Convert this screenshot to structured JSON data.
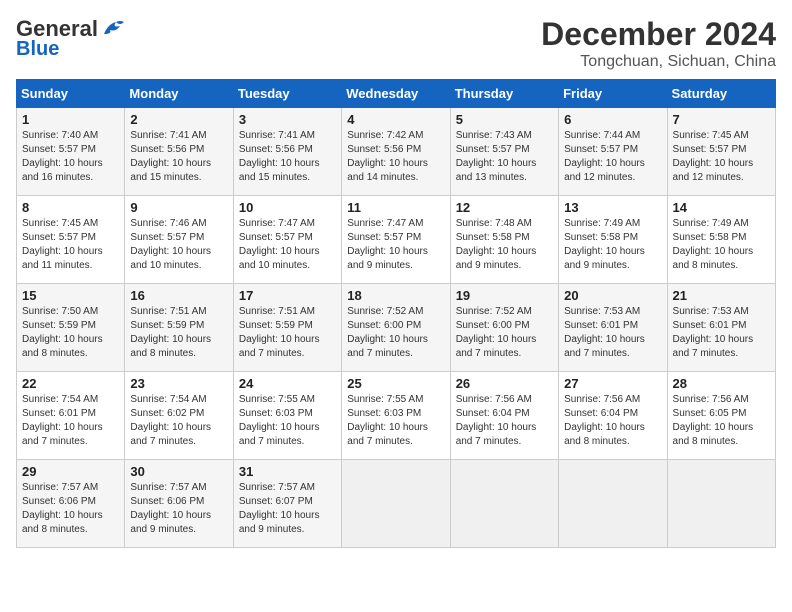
{
  "header": {
    "logo_general": "General",
    "logo_blue": "Blue",
    "month_title": "December 2024",
    "location": "Tongchuan, Sichuan, China"
  },
  "weekdays": [
    "Sunday",
    "Monday",
    "Tuesday",
    "Wednesday",
    "Thursday",
    "Friday",
    "Saturday"
  ],
  "weeks": [
    [
      {
        "day": "1",
        "sunrise": "7:40 AM",
        "sunset": "5:57 PM",
        "daylight": "10 hours and 16 minutes."
      },
      {
        "day": "2",
        "sunrise": "7:41 AM",
        "sunset": "5:56 PM",
        "daylight": "10 hours and 15 minutes."
      },
      {
        "day": "3",
        "sunrise": "7:41 AM",
        "sunset": "5:56 PM",
        "daylight": "10 hours and 15 minutes."
      },
      {
        "day": "4",
        "sunrise": "7:42 AM",
        "sunset": "5:56 PM",
        "daylight": "10 hours and 14 minutes."
      },
      {
        "day": "5",
        "sunrise": "7:43 AM",
        "sunset": "5:57 PM",
        "daylight": "10 hours and 13 minutes."
      },
      {
        "day": "6",
        "sunrise": "7:44 AM",
        "sunset": "5:57 PM",
        "daylight": "10 hours and 12 minutes."
      },
      {
        "day": "7",
        "sunrise": "7:45 AM",
        "sunset": "5:57 PM",
        "daylight": "10 hours and 12 minutes."
      }
    ],
    [
      {
        "day": "8",
        "sunrise": "7:45 AM",
        "sunset": "5:57 PM",
        "daylight": "10 hours and 11 minutes."
      },
      {
        "day": "9",
        "sunrise": "7:46 AM",
        "sunset": "5:57 PM",
        "daylight": "10 hours and 10 minutes."
      },
      {
        "day": "10",
        "sunrise": "7:47 AM",
        "sunset": "5:57 PM",
        "daylight": "10 hours and 10 minutes."
      },
      {
        "day": "11",
        "sunrise": "7:47 AM",
        "sunset": "5:57 PM",
        "daylight": "10 hours and 9 minutes."
      },
      {
        "day": "12",
        "sunrise": "7:48 AM",
        "sunset": "5:58 PM",
        "daylight": "10 hours and 9 minutes."
      },
      {
        "day": "13",
        "sunrise": "7:49 AM",
        "sunset": "5:58 PM",
        "daylight": "10 hours and 9 minutes."
      },
      {
        "day": "14",
        "sunrise": "7:49 AM",
        "sunset": "5:58 PM",
        "daylight": "10 hours and 8 minutes."
      }
    ],
    [
      {
        "day": "15",
        "sunrise": "7:50 AM",
        "sunset": "5:59 PM",
        "daylight": "10 hours and 8 minutes."
      },
      {
        "day": "16",
        "sunrise": "7:51 AM",
        "sunset": "5:59 PM",
        "daylight": "10 hours and 8 minutes."
      },
      {
        "day": "17",
        "sunrise": "7:51 AM",
        "sunset": "5:59 PM",
        "daylight": "10 hours and 7 minutes."
      },
      {
        "day": "18",
        "sunrise": "7:52 AM",
        "sunset": "6:00 PM",
        "daylight": "10 hours and 7 minutes."
      },
      {
        "day": "19",
        "sunrise": "7:52 AM",
        "sunset": "6:00 PM",
        "daylight": "10 hours and 7 minutes."
      },
      {
        "day": "20",
        "sunrise": "7:53 AM",
        "sunset": "6:01 PM",
        "daylight": "10 hours and 7 minutes."
      },
      {
        "day": "21",
        "sunrise": "7:53 AM",
        "sunset": "6:01 PM",
        "daylight": "10 hours and 7 minutes."
      }
    ],
    [
      {
        "day": "22",
        "sunrise": "7:54 AM",
        "sunset": "6:01 PM",
        "daylight": "10 hours and 7 minutes."
      },
      {
        "day": "23",
        "sunrise": "7:54 AM",
        "sunset": "6:02 PM",
        "daylight": "10 hours and 7 minutes."
      },
      {
        "day": "24",
        "sunrise": "7:55 AM",
        "sunset": "6:03 PM",
        "daylight": "10 hours and 7 minutes."
      },
      {
        "day": "25",
        "sunrise": "7:55 AM",
        "sunset": "6:03 PM",
        "daylight": "10 hours and 7 minutes."
      },
      {
        "day": "26",
        "sunrise": "7:56 AM",
        "sunset": "6:04 PM",
        "daylight": "10 hours and 7 minutes."
      },
      {
        "day": "27",
        "sunrise": "7:56 AM",
        "sunset": "6:04 PM",
        "daylight": "10 hours and 8 minutes."
      },
      {
        "day": "28",
        "sunrise": "7:56 AM",
        "sunset": "6:05 PM",
        "daylight": "10 hours and 8 minutes."
      }
    ],
    [
      {
        "day": "29",
        "sunrise": "7:57 AM",
        "sunset": "6:06 PM",
        "daylight": "10 hours and 8 minutes."
      },
      {
        "day": "30",
        "sunrise": "7:57 AM",
        "sunset": "6:06 PM",
        "daylight": "10 hours and 9 minutes."
      },
      {
        "day": "31",
        "sunrise": "7:57 AM",
        "sunset": "6:07 PM",
        "daylight": "10 hours and 9 minutes."
      },
      null,
      null,
      null,
      null
    ]
  ]
}
